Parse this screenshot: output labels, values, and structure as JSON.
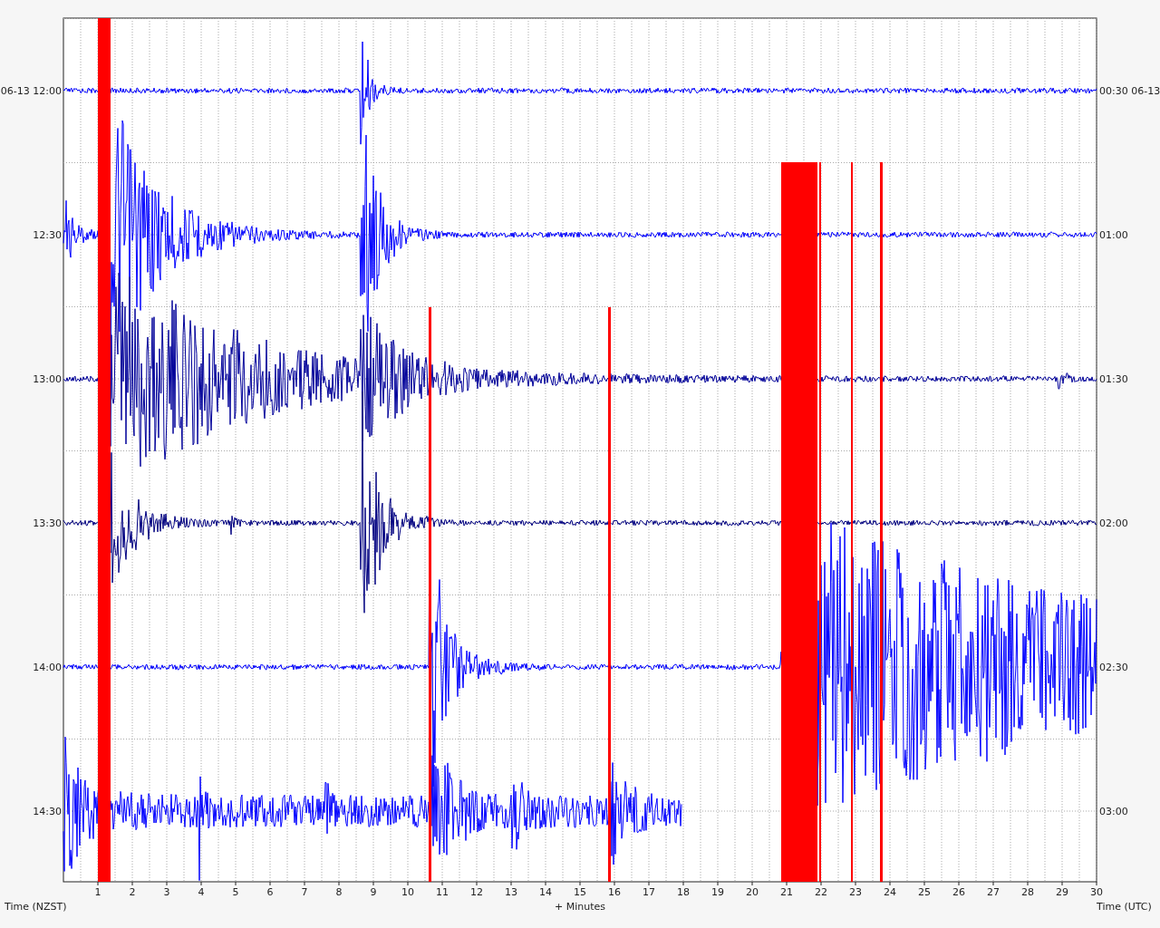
{
  "plot": {
    "rows": [
      {
        "left": "06-13 12:00",
        "right": "00:30 06-13",
        "color": "#0000ff"
      },
      {
        "left": "12:30",
        "right": "01:00",
        "color": "#0000ff"
      },
      {
        "left": "13:00",
        "right": "01:30",
        "color": "#000099"
      },
      {
        "left": "13:30",
        "right": "02:00",
        "color": "#000080"
      },
      {
        "left": "14:00",
        "right": "02:30",
        "color": "#0000ff"
      },
      {
        "left": "14:30",
        "right": "03:00",
        "color": "#0000ff"
      }
    ],
    "x_ticks": [
      "1",
      "2",
      "3",
      "4",
      "5",
      "6",
      "7",
      "8",
      "9",
      "10",
      "11",
      "12",
      "13",
      "14",
      "15",
      "16",
      "17",
      "18",
      "19",
      "20",
      "21",
      "22",
      "23",
      "24",
      "25",
      "26",
      "27",
      "28",
      "29",
      "30"
    ],
    "x_left_label": "Time (NZST)",
    "x_center_label": "+ Minutes",
    "x_right_label": "Time (UTC)"
  }
}
